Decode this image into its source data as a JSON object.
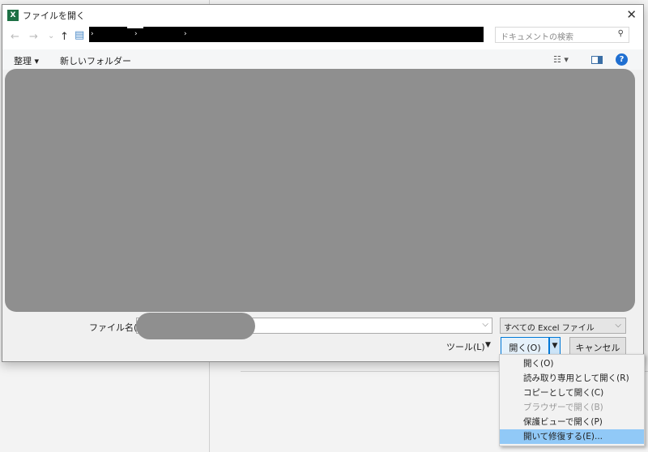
{
  "dialog": {
    "title": "ファイルを開く",
    "close": "✕"
  },
  "nav": {
    "back": "←",
    "forward": "→",
    "recent": "⌄",
    "up": "↑"
  },
  "address": {
    "separators": [
      "›",
      "›",
      "›"
    ]
  },
  "search": {
    "placeholder": "ドキュメントの検索",
    "icon": "⚲"
  },
  "toolbar": {
    "organize": "整理 ▾",
    "new_folder": "新しいフォルダー",
    "view_icon": "☷ ▾",
    "help": "?"
  },
  "filename": {
    "label": "ファイル名(N):",
    "dropdown": "⌵"
  },
  "filter": {
    "selected": "すべての Excel ファイル",
    "dropdown": "⌵"
  },
  "buttons": {
    "tools": "ツール(L)",
    "tools_arrow": "▼",
    "open": "開く(O)",
    "open_arrow": "▼",
    "cancel": "キャンセル"
  },
  "menu": {
    "items": [
      {
        "label": "開く(O)",
        "enabled": true
      },
      {
        "label": "読み取り専用として開く(R)",
        "enabled": true
      },
      {
        "label": "コピーとして開く(C)",
        "enabled": true
      },
      {
        "label": "ブラウザーで開く(B)",
        "enabled": false
      },
      {
        "label": "保護ビューで開く(P)",
        "enabled": true
      },
      {
        "label": "開いて修復する(E)...",
        "enabled": true,
        "highlighted": true
      }
    ]
  }
}
